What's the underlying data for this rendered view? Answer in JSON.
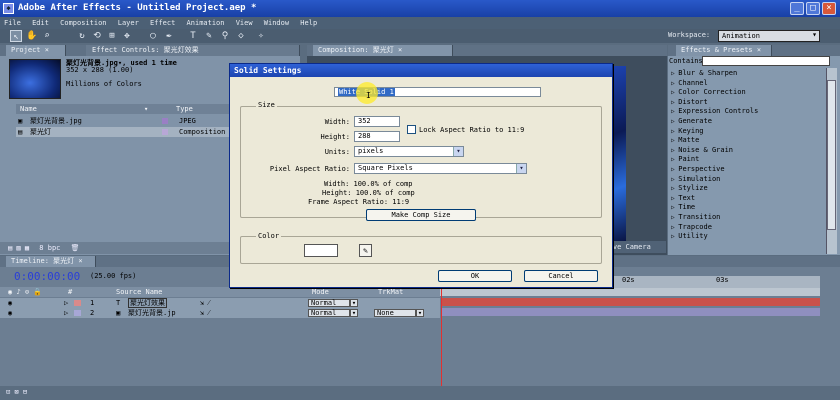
{
  "app": {
    "title": "Adobe After Effects - Untitled Project.aep *"
  },
  "menu": [
    "File",
    "Edit",
    "Composition",
    "Layer",
    "Effect",
    "Animation",
    "View",
    "Window",
    "Help"
  ],
  "workspace": {
    "label": "Workspace:",
    "value": "Animation"
  },
  "project_panel": {
    "tab": "Project",
    "effect_tab": "Effect Controls: 聚光灯效果",
    "item_name": "聚灯光背景.jpg▾, used 1 time",
    "item_dims": "352 x 288 (1.00)",
    "item_colors": "Millions of Colors",
    "col_name": "Name",
    "col_type": "Type",
    "rows": [
      {
        "name": "聚灯光背景.jpg",
        "type": "JPEG"
      },
      {
        "name": "聚光灯",
        "type": "Composition"
      }
    ],
    "bpc": "8 bpc"
  },
  "comp_panel": {
    "tab": "Composition: 聚光灯",
    "active_camera": "Active Camera"
  },
  "effects_panel": {
    "tab": "Effects & Presets",
    "contains": "Contains:",
    "items": [
      "Blur & Sharpen",
      "Channel",
      "Color Correction",
      "Distort",
      "Expression Controls",
      "Generate",
      "Keying",
      "Matte",
      "Noise & Grain",
      "Paint",
      "Perspective",
      "Simulation",
      "Stylize",
      "Text",
      "Time",
      "Transition",
      "Trapcode",
      "Utility"
    ]
  },
  "timeline": {
    "tab": "Timeline: 聚光灯",
    "timecode": "0:00:00:00",
    "fps": "(25.00 fps)",
    "col_source": "Source Name",
    "col_mode": "Mode",
    "col_trkmat": "TrkMat",
    "ruler_2": "02s",
    "ruler_3": "03s",
    "layers": [
      {
        "num": "1",
        "name": "聚光灯效果",
        "mode": "Normal"
      },
      {
        "num": "2",
        "name": "聚灯光背景.jp",
        "mode": "Normal",
        "trkmat": "None"
      }
    ]
  },
  "dialog": {
    "title": "Solid Settings",
    "name_label": "Name:",
    "name_value": "White Solid 1",
    "size_group": "Size",
    "width_label": "Width:",
    "width_value": "352",
    "height_label": "Height:",
    "height_value": "288",
    "lock_label": "Lock Aspect Ratio to 11:9",
    "units_label": "Units:",
    "units_value": "pixels",
    "par_label": "Pixel Aspect Ratio:",
    "par_value": "Square Pixels",
    "info_width": "Width:  100.0% of comp",
    "info_height": "Height:  100.0% of comp",
    "info_frame": "Frame Aspect Ratio: 11:9",
    "make_comp": "Make Comp Size",
    "color_group": "Color",
    "color_value": "#ffffff",
    "ok": "OK",
    "cancel": "Cancel"
  }
}
